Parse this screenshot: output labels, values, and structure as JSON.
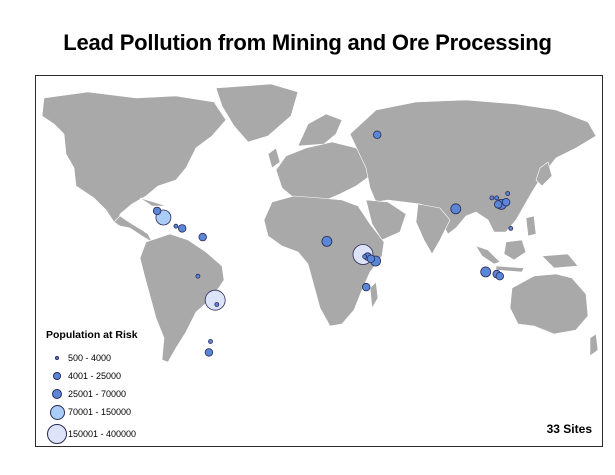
{
  "title": "Lead Pollution from Mining and Ore Processing",
  "legend": {
    "title": "Population at Risk",
    "classes": [
      {
        "label": "500 - 4000",
        "size_class": 1,
        "color": "#5a86d8"
      },
      {
        "label": "4001 - 25000",
        "size_class": 2,
        "color": "#5a86d8"
      },
      {
        "label": "25001 - 70000",
        "size_class": 3,
        "color": "#5a86d8"
      },
      {
        "label": "70001 - 150000",
        "size_class": 4,
        "color": "#a9cdf7"
      },
      {
        "label": "150001 - 400000",
        "size_class": 5,
        "color": "#dde4fa"
      }
    ]
  },
  "sites_count": "33 Sites",
  "colors": {
    "land": "#a9a9a9",
    "ocean": "#ffffff",
    "site_outline": "#2a2a55"
  },
  "sites": [
    {
      "lon": -103,
      "lat": 22,
      "size_class": 2
    },
    {
      "lon": -99,
      "lat": 19,
      "size_class": 4
    },
    {
      "lon": -91,
      "lat": 15,
      "size_class": 1
    },
    {
      "lon": -87,
      "lat": 14,
      "size_class": 2
    },
    {
      "lon": -74,
      "lat": 10,
      "size_class": 2
    },
    {
      "lon": -77,
      "lat": -8,
      "size_class": 1
    },
    {
      "lon": -66,
      "lat": -19,
      "size_class": 5
    },
    {
      "lon": -65,
      "lat": -21,
      "size_class": 1
    },
    {
      "lon": -69,
      "lat": -38,
      "size_class": 1
    },
    {
      "lon": -70,
      "lat": -43,
      "size_class": 2
    },
    {
      "lon": 37,
      "lat": 57,
      "size_class": 2
    },
    {
      "lon": 5,
      "lat": 8,
      "size_class": 3
    },
    {
      "lon": 28,
      "lat": 2,
      "size_class": 5
    },
    {
      "lon": 29,
      "lat": 1,
      "size_class": 1
    },
    {
      "lon": 31,
      "lat": 1,
      "size_class": 2
    },
    {
      "lon": 33,
      "lat": 0,
      "size_class": 2
    },
    {
      "lon": 36,
      "lat": -1,
      "size_class": 3
    },
    {
      "lon": 30,
      "lat": -13,
      "size_class": 2
    },
    {
      "lon": 87,
      "lat": 23,
      "size_class": 3
    },
    {
      "lon": 110,
      "lat": 28,
      "size_class": 1
    },
    {
      "lon": 113,
      "lat": 28,
      "size_class": 1
    },
    {
      "lon": 114,
      "lat": 25,
      "size_class": 2
    },
    {
      "lon": 116,
      "lat": 25,
      "size_class": 3
    },
    {
      "lon": 119,
      "lat": 26,
      "size_class": 2
    },
    {
      "lon": 120,
      "lat": 30,
      "size_class": 1
    },
    {
      "lon": 122,
      "lat": 14,
      "size_class": 1
    },
    {
      "lon": 106,
      "lat": -6,
      "size_class": 3
    },
    {
      "lon": 113,
      "lat": -7,
      "size_class": 2
    },
    {
      "lon": 115,
      "lat": -8,
      "size_class": 2
    }
  ]
}
